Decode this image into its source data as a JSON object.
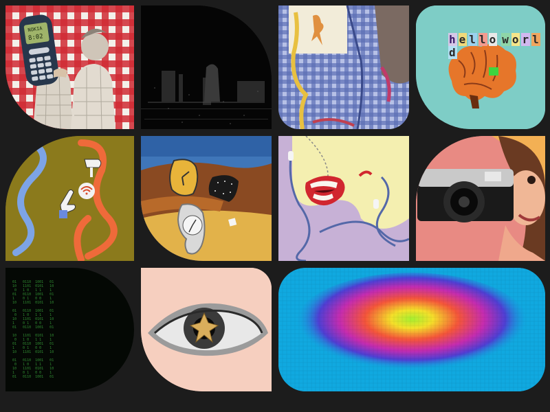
{
  "tiles": {
    "t1": {
      "name": "retro-phone-collage"
    },
    "t2": {
      "name": "dark-noise-photo"
    },
    "t3": {
      "name": "gingham-lizard-embroidery"
    },
    "t4": {
      "name": "hello-world-brain",
      "hello_text": [
        "h",
        "e",
        "l",
        "l",
        "o",
        " ",
        "w",
        "o",
        "r",
        "l",
        "d"
      ]
    },
    "t5": {
      "name": "hands-wifi-lines"
    },
    "t6": {
      "name": "melting-clocks"
    },
    "t7": {
      "name": "mouth-earphones"
    },
    "t8": {
      "name": "camera-woman"
    },
    "t9": {
      "name": "matrix-code"
    },
    "t10": {
      "name": "eye-cross"
    },
    "t11": {
      "name": "heatmap-blob"
    }
  },
  "colors": {
    "background": "#1c1c1c",
    "red_check": "#c8202c",
    "teal": "#7ecdc6",
    "olive": "#8b7a1c",
    "lilac": "#c7b1d6",
    "peach": "#f6cfbf",
    "heat_blue": "#10a9e0",
    "matrix_green": "#39a53b"
  }
}
